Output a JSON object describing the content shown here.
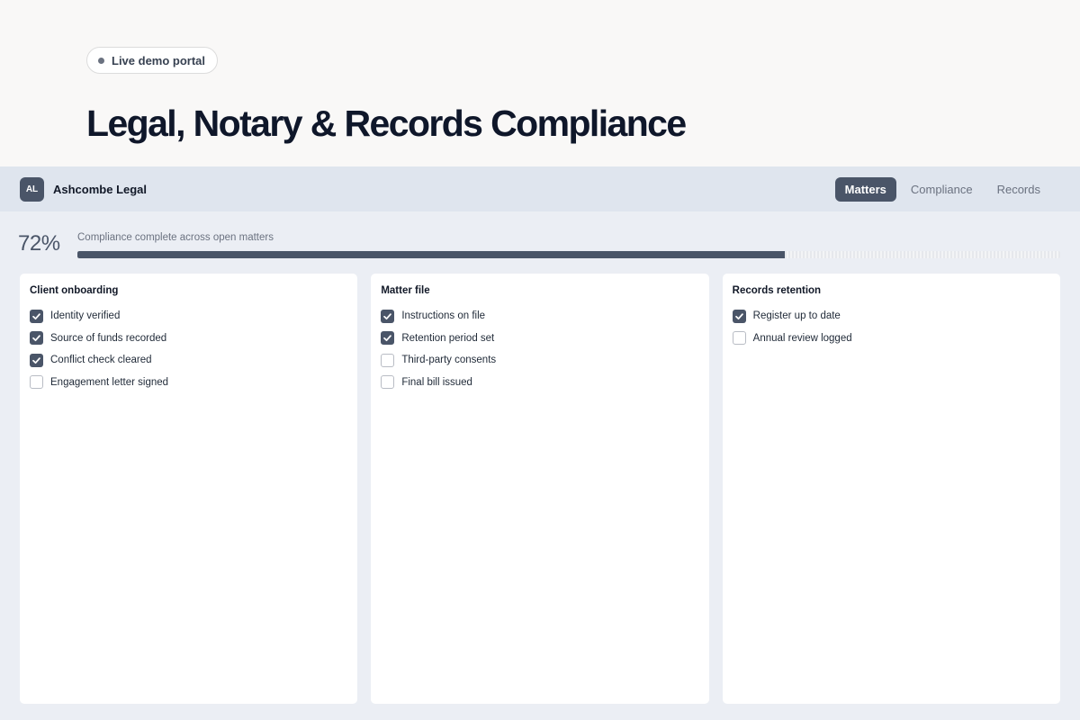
{
  "hero": {
    "badge": "Live demo portal",
    "title": "Legal, Notary & Records Compliance"
  },
  "app": {
    "avatar": "AL",
    "brand": "Ashcombe Legal",
    "nav": [
      {
        "label": "Matters",
        "active": true
      },
      {
        "label": "Compliance",
        "active": false
      },
      {
        "label": "Records",
        "active": false
      }
    ]
  },
  "progress": {
    "percent_text": "72%",
    "value": 0.72,
    "label": "Compliance complete across open matters"
  },
  "cards": [
    {
      "title": "Client onboarding",
      "items": [
        {
          "label": "Identity verified",
          "checked": true
        },
        {
          "label": "Source of funds recorded",
          "checked": true
        },
        {
          "label": "Conflict check cleared",
          "checked": true
        },
        {
          "label": "Engagement letter signed",
          "checked": false
        }
      ]
    },
    {
      "title": "Matter file",
      "items": [
        {
          "label": "Instructions on file",
          "checked": true
        },
        {
          "label": "Retention period set",
          "checked": true
        },
        {
          "label": "Third-party consents",
          "checked": false
        },
        {
          "label": "Final bill issued",
          "checked": false
        }
      ]
    },
    {
      "title": "Records retention",
      "items": [
        {
          "label": "Register up to date",
          "checked": true
        },
        {
          "label": "Annual review logged",
          "checked": false
        }
      ]
    }
  ],
  "colors": {
    "accent": "#4a5568",
    "topbar": "#dfe5ee",
    "app_bg": "#ebeef4"
  }
}
